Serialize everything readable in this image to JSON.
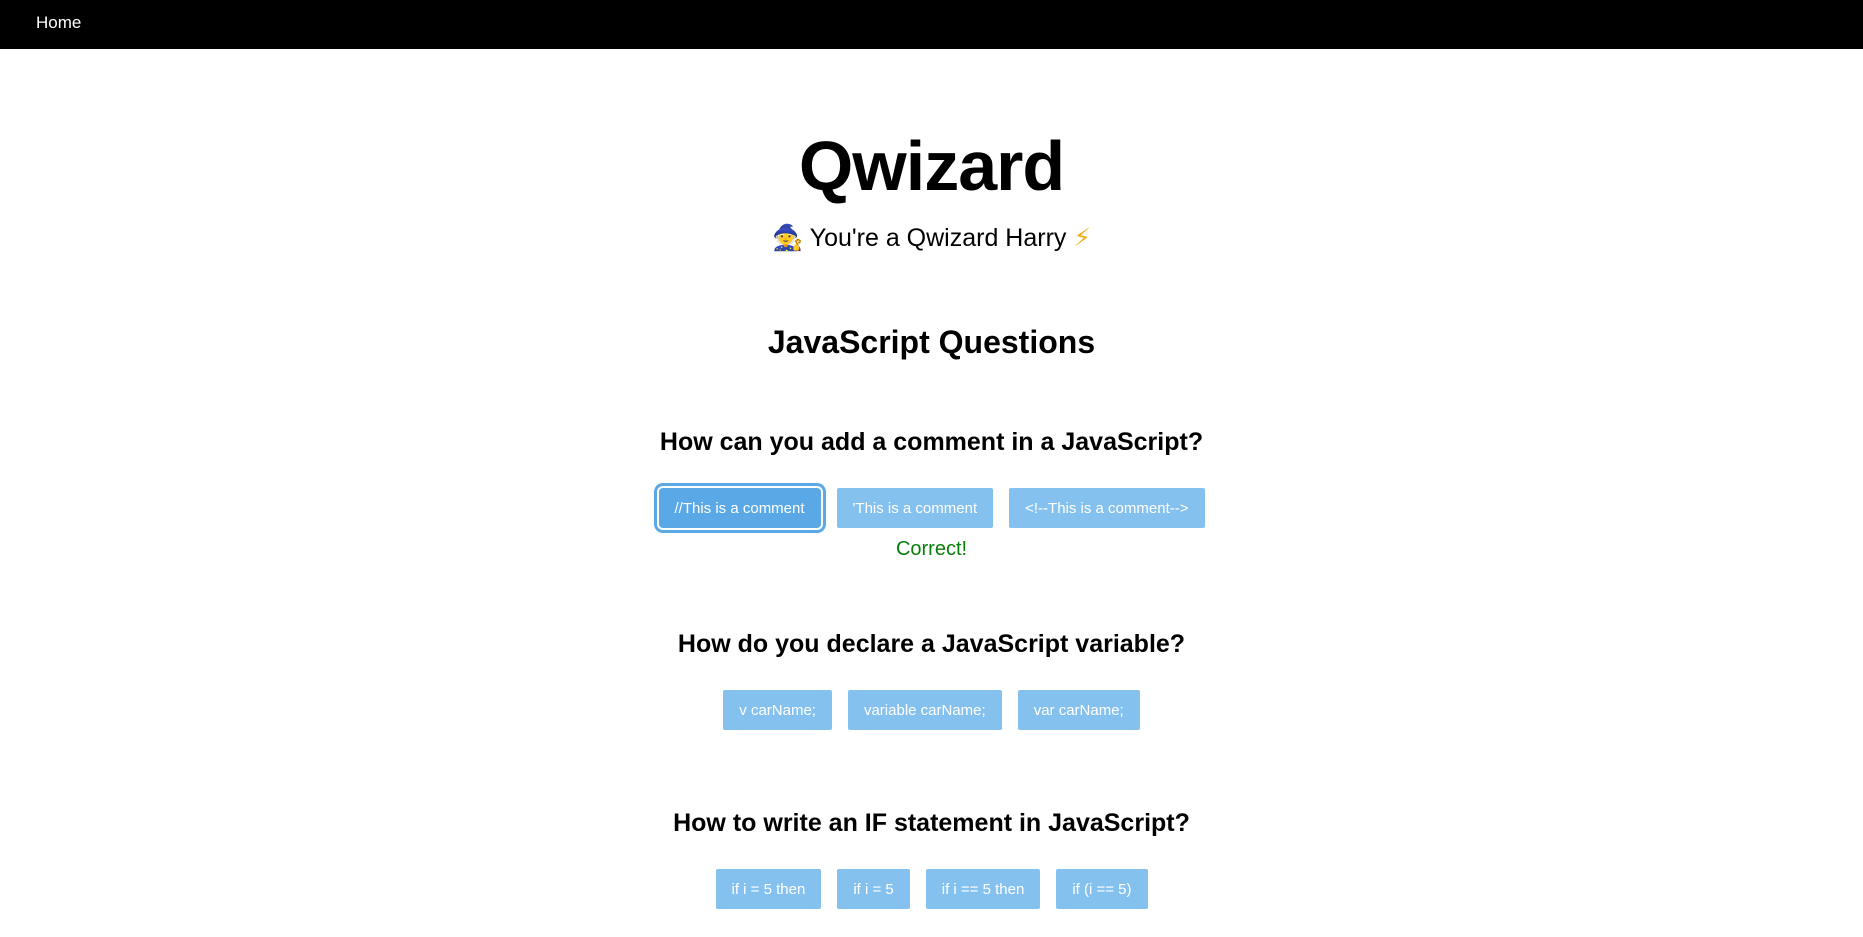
{
  "nav": {
    "home_label": "Home"
  },
  "header": {
    "title": "Qwizard",
    "subtitle_icon": "🧙",
    "subtitle_text": "You're a Qwizard Harry",
    "subtitle_bolt": "⚡"
  },
  "section": {
    "heading": "JavaScript Questions"
  },
  "questions": [
    {
      "question": "How can you add a comment in a JavaScript?",
      "answers": [
        "//This is a comment",
        "'This is a comment",
        "<!--This is a comment-->"
      ],
      "selected": 0,
      "feedback": "Correct!"
    },
    {
      "question": "How do you declare a JavaScript variable?",
      "answers": [
        "v carName;",
        "variable carName;",
        "var carName;"
      ]
    },
    {
      "question": "How to write an IF statement in JavaScript?",
      "answers": [
        "if i = 5 then",
        "if i = 5",
        "if i == 5 then",
        "if (i == 5)"
      ]
    }
  ],
  "colors": {
    "navbar": "#000000",
    "answer_button": "#85c1ee",
    "answer_button_selected": "#5aa9e6",
    "correct_text": "#0a7d0a"
  }
}
